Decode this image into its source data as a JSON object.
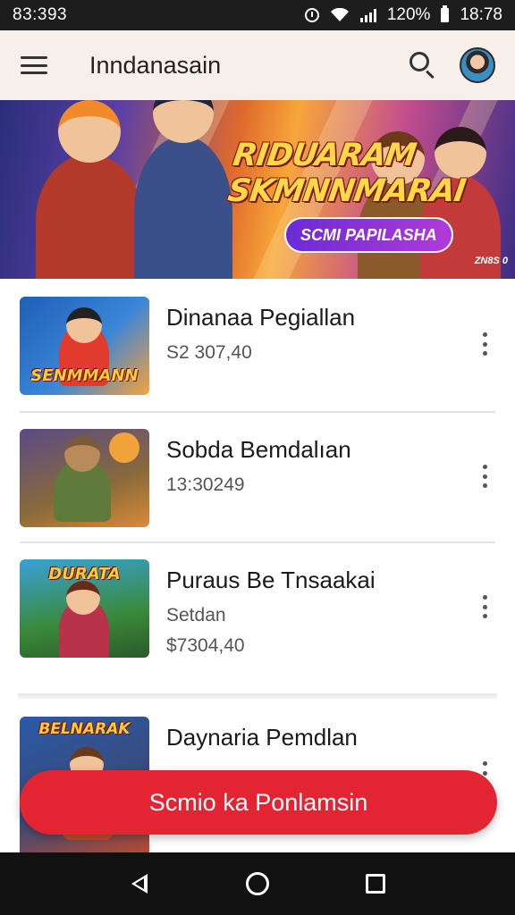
{
  "status_bar": {
    "time_left": "83:393",
    "battery_text": "120%",
    "clock": "18:78",
    "icons": [
      "alarm-icon",
      "wifi-icon",
      "signal-icon",
      "battery-icon"
    ]
  },
  "app_bar": {
    "title": "Inndanasain",
    "icons": [
      "menu-icon",
      "search-icon",
      "avatar"
    ]
  },
  "banner": {
    "title_line1": "RIDUARAM",
    "title_line2": "SKMNNMARAI",
    "pill_label": "SCMI PAPILASHA",
    "corner_tag": "ZN8S 0"
  },
  "games": [
    {
      "name": "Dinanaa Pegiallan",
      "subtitle": "",
      "price": "S2 307,40",
      "thumb_logo": "SENMMANN",
      "thumb_colors": [
        "#1f5fb8",
        "#e23b2d",
        "#f6a23a"
      ]
    },
    {
      "name": "Sobda Bemdalıan",
      "subtitle": "",
      "price": "13:30249",
      "thumb_logo": "",
      "thumb_colors": [
        "#5a4a86",
        "#8a6a3a",
        "#d98a3a"
      ]
    },
    {
      "name": "Puraus Be Tnsaakai",
      "subtitle": "Setdan",
      "price": "$7304,40",
      "thumb_logo": "DURATA",
      "thumb_colors": [
        "#3a8a3a",
        "#b8324a",
        "#f2c033"
      ]
    },
    {
      "name": "Daynaria Pemdlan",
      "subtitle": "",
      "price": "",
      "thumb_logo": "BELNARAK",
      "thumb_colors": [
        "#2a5aa8",
        "#c24a2a",
        "#f0b040"
      ]
    }
  ],
  "cta": {
    "label": "Scmio ka Ponlamsin"
  },
  "nav_bar": {
    "icons": [
      "back-icon",
      "home-icon",
      "recents-icon"
    ]
  },
  "colors": {
    "accent": "#e32533",
    "app_bar_bg": "#f7efe9",
    "status_bar_bg": "#1d1d1d",
    "nav_bar_bg": "#111111"
  }
}
